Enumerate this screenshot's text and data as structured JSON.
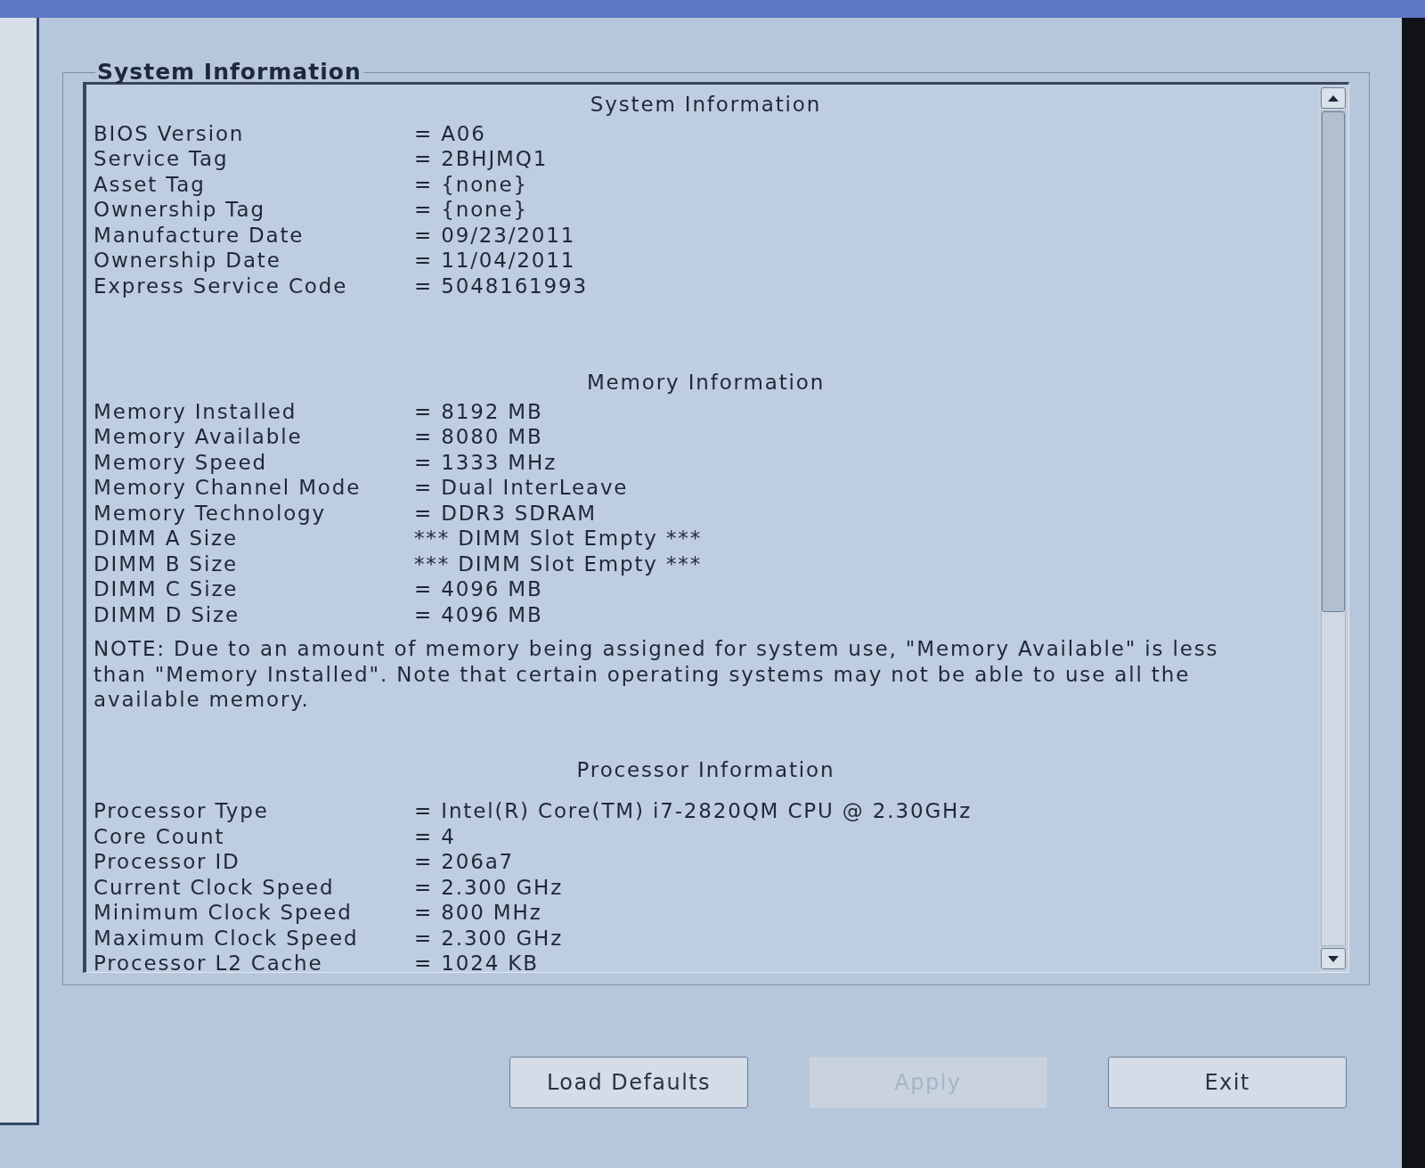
{
  "group_box": {
    "title": "System Information"
  },
  "sections": [
    {
      "heading": "System Information",
      "rows": [
        {
          "label": "BIOS Version",
          "value": "= A06"
        },
        {
          "label": "Service Tag",
          "value": "= 2BHJMQ1"
        },
        {
          "label": "Asset Tag",
          "value": "= {none}"
        },
        {
          "label": "Ownership Tag",
          "value": "= {none}"
        },
        {
          "label": "Manufacture Date",
          "value": "= 09/23/2011"
        },
        {
          "label": "Ownership Date",
          "value": "= 11/04/2011"
        },
        {
          "label": "Express Service Code",
          "value": "= 5048161993"
        }
      ]
    },
    {
      "heading": "Memory Information",
      "rows": [
        {
          "label": "Memory Installed",
          "value": "= 8192 MB"
        },
        {
          "label": "Memory Available",
          "value": "= 8080 MB"
        },
        {
          "label": "Memory Speed",
          "value": "= 1333 MHz"
        },
        {
          "label": "Memory Channel Mode",
          "value": "= Dual InterLeave"
        },
        {
          "label": "Memory Technology",
          "value": "= DDR3 SDRAM"
        },
        {
          "label": "DIMM A Size",
          "value": "*** DIMM Slot Empty ***"
        },
        {
          "label": "DIMM B Size",
          "value": "*** DIMM Slot Empty ***"
        },
        {
          "label": "DIMM C Size",
          "value": "= 4096 MB"
        },
        {
          "label": "DIMM D Size",
          "value": "= 4096 MB"
        }
      ],
      "note": "NOTE: Due to an amount of memory being assigned for system use, \"Memory Available\" is less than \"Memory Installed\". Note that certain operating systems may not be able to use all the available memory."
    },
    {
      "heading": "Processor Information",
      "rows": [
        {
          "label": "Processor Type",
          "value": "= Intel(R) Core(TM) i7-2820QM CPU @ 2.30GHz"
        },
        {
          "label": "Core Count",
          "value": "= 4"
        },
        {
          "label": "Processor ID",
          "value": "= 206a7"
        },
        {
          "label": "Current Clock Speed",
          "value": "= 2.300 GHz"
        },
        {
          "label": "Minimum Clock Speed",
          "value": "= 800 MHz"
        },
        {
          "label": "Maximum Clock Speed",
          "value": "= 2.300 GHz"
        },
        {
          "label": "Processor L2 Cache",
          "value": "= 1024 KB"
        }
      ]
    }
  ],
  "buttons": [
    {
      "label": "Load Defaults",
      "disabled": false
    },
    {
      "label": "Apply",
      "disabled": true
    },
    {
      "label": "Exit",
      "disabled": false
    }
  ]
}
